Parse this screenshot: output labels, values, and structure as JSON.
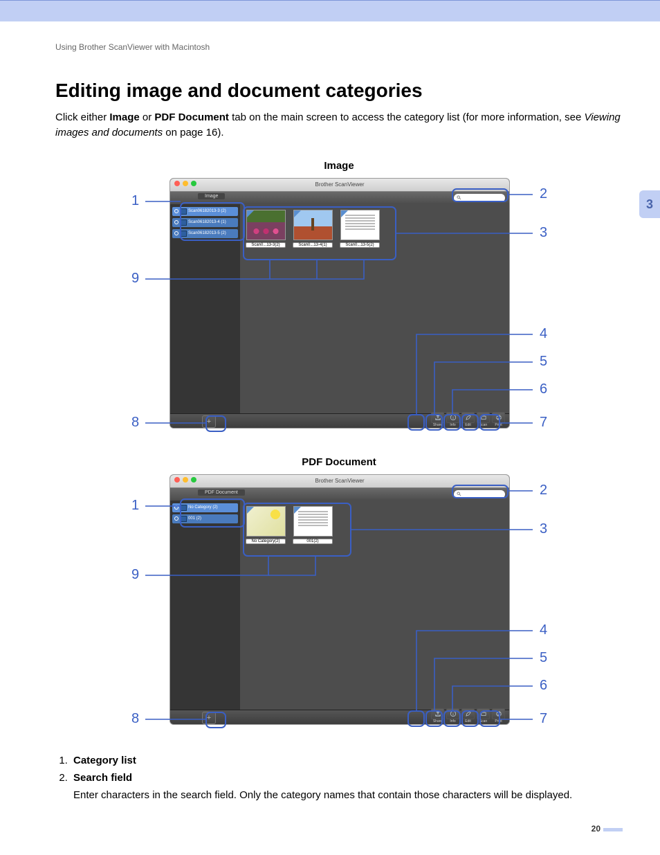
{
  "breadcrumb": "Using Brother ScanViewer with Macintosh",
  "heading": "Editing image and document categories",
  "intro_pre": "Click either ",
  "intro_b1": "Image",
  "intro_mid1": " or ",
  "intro_b2": "PDF Document",
  "intro_mid2": " tab on the main screen to access the category list (for more information, see ",
  "intro_em": "Viewing images and documents",
  "intro_post": " on page 16).",
  "chapter_number": "3",
  "figures": {
    "image": {
      "caption": "Image",
      "window_title": "Brother ScanViewer",
      "tab_label": "Image",
      "categories": [
        "Scan06182013-3 (2)",
        "Scan06182013-4 (1)",
        "Scan06182013-5 (2)"
      ],
      "thumbs": [
        "Scan0...13-3(2)",
        "Scan0...13-4(1)",
        "Scan0...13-5(2)"
      ]
    },
    "pdf": {
      "caption": "PDF Document",
      "window_title": "Brother ScanViewer",
      "tab_label": "PDF Document",
      "categories": [
        "No Category (2)",
        "001 (2)"
      ],
      "thumbs": [
        "No Category(2)",
        "001(2)"
      ]
    }
  },
  "toolbar_icons": {
    "share": "Share",
    "info": "Info",
    "edit": "Edit",
    "scan": "Scan",
    "print": "Print"
  },
  "callouts": {
    "n1": "1",
    "n2": "2",
    "n3": "3",
    "n4": "4",
    "n5": "5",
    "n6": "6",
    "n7": "7",
    "n8": "8",
    "n9": "9"
  },
  "legend": [
    {
      "title": "Category list"
    },
    {
      "title": "Search field",
      "desc": "Enter characters in the search field. Only the category names that contain those characters will be displayed."
    }
  ],
  "page_number": "20"
}
